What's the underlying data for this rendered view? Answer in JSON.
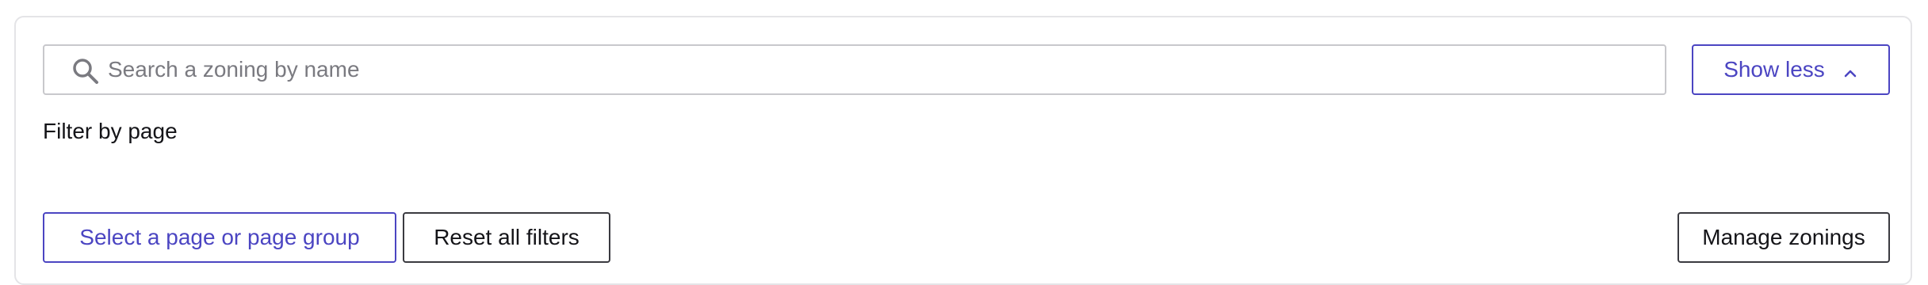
{
  "search": {
    "placeholder": "Search a zoning by name",
    "value": ""
  },
  "toggle": {
    "label": "Show less",
    "icon": "chevron-up-icon"
  },
  "filters": {
    "title": "Filter by page",
    "select_page_label": "Select a page or page group",
    "reset_label": "Reset all filters"
  },
  "actions": {
    "manage_label": "Manage zonings"
  },
  "colors": {
    "accent": "#4b45c2",
    "border": "#c8c8cc",
    "text": "#141418",
    "placeholder": "#7a7a80"
  }
}
